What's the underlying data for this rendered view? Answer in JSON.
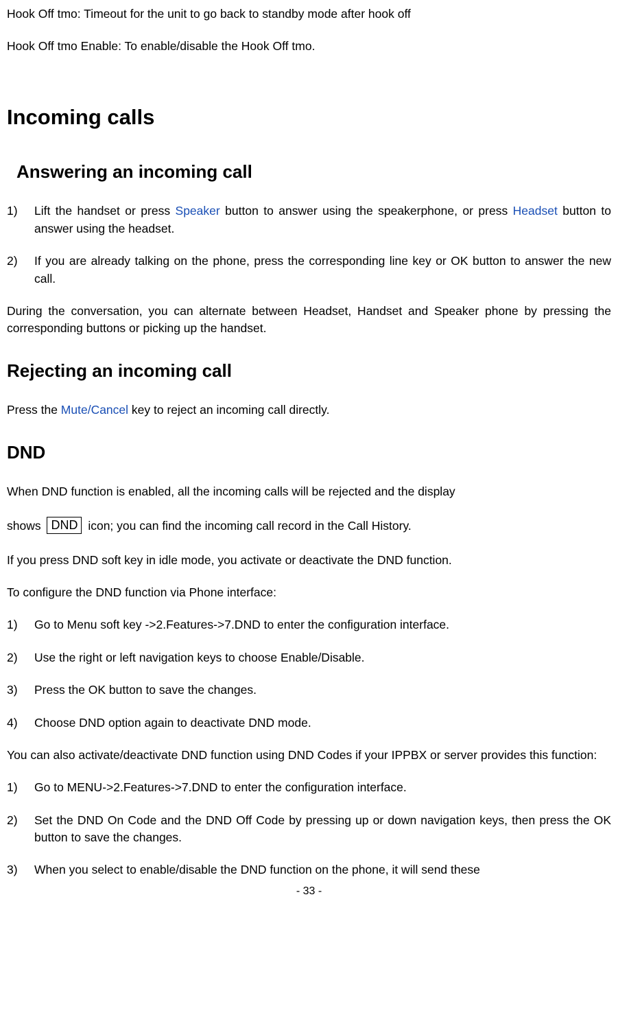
{
  "intro": {
    "p1": "Hook Off tmo: Timeout for the unit to go back to standby mode after hook off",
    "p2": "Hook Off tmo Enable: To enable/disable the Hook Off tmo."
  },
  "h1": "Incoming calls",
  "answering": {
    "heading": "Answering an incoming call",
    "item1_num": "1)",
    "item1_a": "Lift the handset or press ",
    "item1_link1": "Speaker",
    "item1_b": " button to answer using the speakerphone, or press ",
    "item1_link2": "Headset",
    "item1_c": " button to answer using the headset.",
    "item2_num": "2)",
    "item2": "If you are already talking on the phone, press the corresponding line key or OK button to answer the new call.",
    "p3": "During the conversation, you can alternate between Headset, Handset and Speaker phone by pressing the corresponding buttons or picking up the handset."
  },
  "rejecting": {
    "heading": "Rejecting an incoming call",
    "p_a": "Press the ",
    "p_link": "Mute/Cancel",
    "p_b": " key to reject an incoming call directly."
  },
  "dnd": {
    "heading": "DND",
    "p1_a": "When DND function is enabled, all the incoming calls will be rejected and the display",
    "p1_b": "shows ",
    "icon_label": "DND",
    "p1_c": " icon; you can find the incoming call record in the Call History.",
    "p2": "If you press DND soft key in idle mode, you activate or deactivate the DND function.",
    "p3": "To configure the DND function via Phone interface:",
    "list1": {
      "n1": "1)",
      "t1": "Go to Menu soft key ->2.Features->7.DND to enter the configuration interface.",
      "n2": "2)",
      "t2": "Use the right or left navigation keys to choose Enable/Disable.",
      "n3": "3)",
      "t3": "Press the OK button to save the changes.",
      "n4": "4)",
      "t4": "Choose DND option again to deactivate DND mode."
    },
    "p4": "You can also activate/deactivate DND function using DND Codes if your IPPBX or server provides this function:",
    "list2": {
      "n1": "1)",
      "t1": "Go to MENU->2.Features->7.DND to enter the configuration interface.",
      "n2": "2)",
      "t2": "Set the DND On Code and the DND Off Code by pressing up or down navigation keys, then press the OK button to save the changes.",
      "n3": "3)",
      "t3": "When you select to enable/disable the DND function on the phone, it will send these"
    }
  },
  "page_number": "- 33 -"
}
